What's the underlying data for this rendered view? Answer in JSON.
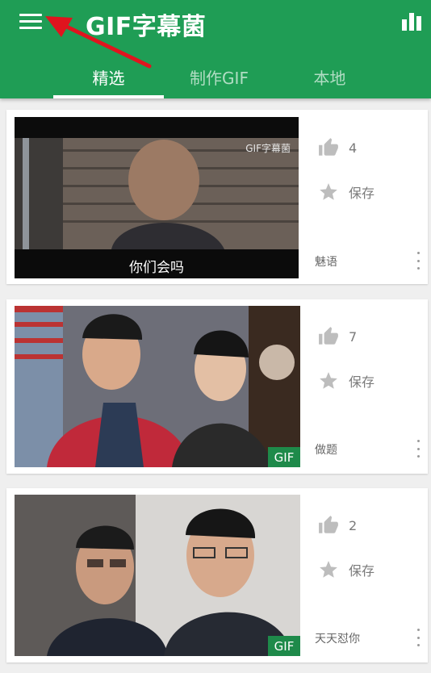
{
  "app": {
    "title": "GIF字幕菌"
  },
  "tabs": [
    {
      "label": "精选",
      "active": true
    },
    {
      "label": "制作GIF",
      "active": false
    },
    {
      "label": "本地",
      "active": false
    }
  ],
  "feed": [
    {
      "likes": "4",
      "save_label": "保存",
      "caption": "魅语",
      "gif_badge": "",
      "subtitle": "你们会吗",
      "watermark": "GIF字幕菌"
    },
    {
      "likes": "7",
      "save_label": "保存",
      "caption": "做题",
      "gif_badge": "GIF"
    },
    {
      "likes": "2",
      "save_label": "保存",
      "caption": "天天怼你",
      "gif_badge": "GIF"
    }
  ],
  "colors": {
    "primary": "#1f9d55",
    "badge": "#1e8a4a",
    "arrow": "#e0141e"
  }
}
